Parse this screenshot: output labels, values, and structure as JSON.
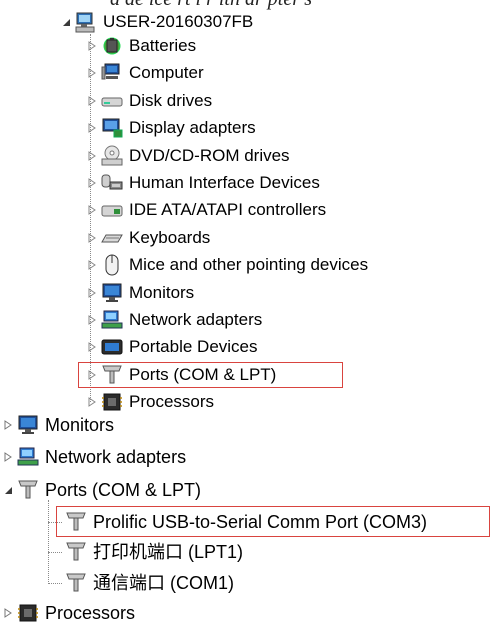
{
  "caption": "d de ice rt l r ith dr pter's",
  "computer_name": "USER-20160307FB",
  "tree_categories": [
    {
      "label": "Batteries",
      "icon": "battery-icon"
    },
    {
      "label": "Computer",
      "icon": "computer-icon"
    },
    {
      "label": "Disk drives",
      "icon": "disk-drive-icon"
    },
    {
      "label": "Display adapters",
      "icon": "display-adapter-icon"
    },
    {
      "label": "DVD/CD-ROM drives",
      "icon": "dvd-drive-icon"
    },
    {
      "label": "Human Interface Devices",
      "icon": "hid-icon"
    },
    {
      "label": "IDE ATA/ATAPI controllers",
      "icon": "ide-controller-icon"
    },
    {
      "label": "Keyboards",
      "icon": "keyboard-icon"
    },
    {
      "label": "Mice and other pointing devices",
      "icon": "mouse-icon"
    },
    {
      "label": "Monitors",
      "icon": "monitor-icon"
    },
    {
      "label": "Network adapters",
      "icon": "network-adapter-icon"
    },
    {
      "label": "Portable Devices",
      "icon": "portable-device-icon"
    },
    {
      "label": "Ports (COM & LPT)",
      "icon": "port-icon"
    },
    {
      "label": "Processors",
      "icon": "processor-icon"
    }
  ],
  "lower_tree": {
    "monitors": "Monitors",
    "network_adapters": "Network adapters",
    "ports": "Ports (COM & LPT)",
    "ports_children": [
      "Prolific USB-to-Serial Comm Port (COM3)",
      "打印机端口 (LPT1)",
      "通信端口 (COM1)"
    ],
    "processors": "Processors"
  },
  "highlight_color": "#d9443f"
}
